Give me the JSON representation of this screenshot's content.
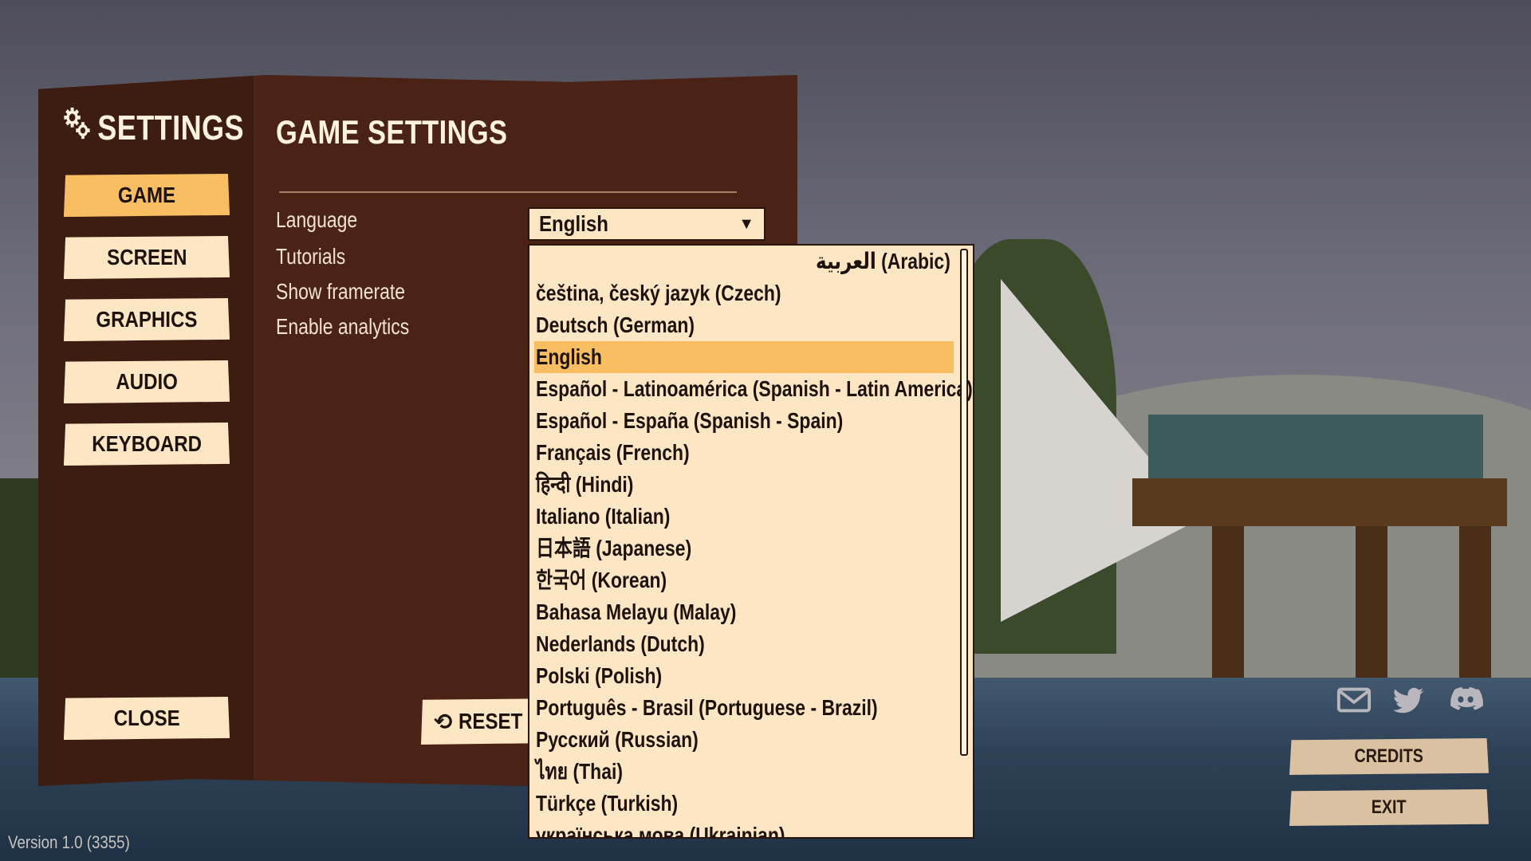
{
  "sidebar": {
    "title": "SETTINGS",
    "title_icon": "gears-icon",
    "nav": [
      {
        "label": "GAME",
        "active": true
      },
      {
        "label": "SCREEN",
        "active": false
      },
      {
        "label": "GRAPHICS",
        "active": false
      },
      {
        "label": "AUDIO",
        "active": false
      },
      {
        "label": "KEYBOARD",
        "active": false
      }
    ],
    "close_label": "CLOSE"
  },
  "main": {
    "title": "GAME SETTINGS",
    "options": [
      {
        "label": "Language"
      },
      {
        "label": "Tutorials"
      },
      {
        "label": "Show framerate"
      },
      {
        "label": "Enable analytics"
      }
    ],
    "language_select": {
      "value": "English",
      "caret_icon": "caret-down-icon"
    },
    "reset_label": "RESET TO",
    "reset_icon": "reset-icon"
  },
  "dropdown": {
    "items": [
      {
        "label": "العربية (Arabic)",
        "rtl": true
      },
      {
        "label": "čeština, český jazyk (Czech)"
      },
      {
        "label": "Deutsch (German)"
      },
      {
        "label": "English",
        "selected": true
      },
      {
        "label": "Español - Latinoamérica (Spanish - Latin America)"
      },
      {
        "label": "Español - España (Spanish - Spain)"
      },
      {
        "label": "Français (French)"
      },
      {
        "label": "हिन्दी (Hindi)"
      },
      {
        "label": "Italiano (Italian)"
      },
      {
        "label": "日本語 (Japanese)"
      },
      {
        "label": "한국어 (Korean)"
      },
      {
        "label": "Bahasa Melayu (Malay)"
      },
      {
        "label": "Nederlands (Dutch)"
      },
      {
        "label": "Polski (Polish)"
      },
      {
        "label": "Português - Brasil (Portuguese - Brazil)"
      },
      {
        "label": "Русский (Russian)"
      },
      {
        "label": "ไทย (Thai)"
      },
      {
        "label": "Türkçe (Turkish)"
      },
      {
        "label": "українська мова (Ukrainian)"
      }
    ]
  },
  "footer": {
    "social": [
      "mail-icon",
      "twitter-icon",
      "discord-icon"
    ],
    "credits_label": "CREDITS",
    "exit_label": "EXIT",
    "version": "Version 1.0 (3355)"
  },
  "colors": {
    "panel": "#4a2316",
    "sidebar": "#3d1c11",
    "button": "#fde6c3",
    "active": "#f9bd62",
    "text_light": "#fff3dd"
  }
}
